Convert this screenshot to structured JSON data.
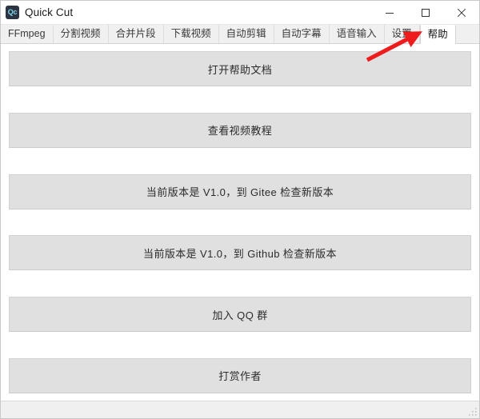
{
  "window": {
    "title": "Quick Cut",
    "icon_label": "Qc",
    "icon_name": "app-icon-quick-cut",
    "controls": {
      "minimize_name": "minimize-icon",
      "maximize_name": "maximize-icon",
      "close_name": "close-icon"
    }
  },
  "tabs": [
    {
      "label": "FFmpeg",
      "selected": false
    },
    {
      "label": "分割视频",
      "selected": false
    },
    {
      "label": "合并片段",
      "selected": false
    },
    {
      "label": "下载视频",
      "selected": false
    },
    {
      "label": "自动剪辑",
      "selected": false
    },
    {
      "label": "自动字幕",
      "selected": false
    },
    {
      "label": "语音输入",
      "selected": false
    },
    {
      "label": "设置",
      "selected": false
    },
    {
      "label": "帮助",
      "selected": true
    }
  ],
  "main": {
    "buttons": [
      {
        "label": "打开帮助文档",
        "name": "open-help-doc-button"
      },
      {
        "label": "查看视频教程",
        "name": "view-video-tutorial-button"
      },
      {
        "label": "当前版本是 V1.0，到 Gitee 检查新版本",
        "name": "check-update-gitee-button"
      },
      {
        "label": "当前版本是 V1.0，到 Github 检查新版本",
        "name": "check-update-github-button"
      },
      {
        "label": "加入 QQ 群",
        "name": "join-qq-group-button"
      },
      {
        "label": "打赏作者",
        "name": "donate-author-button"
      }
    ]
  },
  "status_bar": {
    "text": "",
    "grip_name": "resize-grip"
  },
  "annotation": {
    "arrow_name": "red-arrow-annotation",
    "color": "#ee1c1c",
    "points_to": "帮助"
  },
  "colors": {
    "button_face": "#e0e0e0",
    "tab_bar": "#f0f0f0",
    "selected_tab": "#ffffff",
    "window_bg": "#ffffff",
    "icon_bg": "#2b3440",
    "icon_fg": "#7fd3e8",
    "arrow_red": "#ee1c1c"
  }
}
